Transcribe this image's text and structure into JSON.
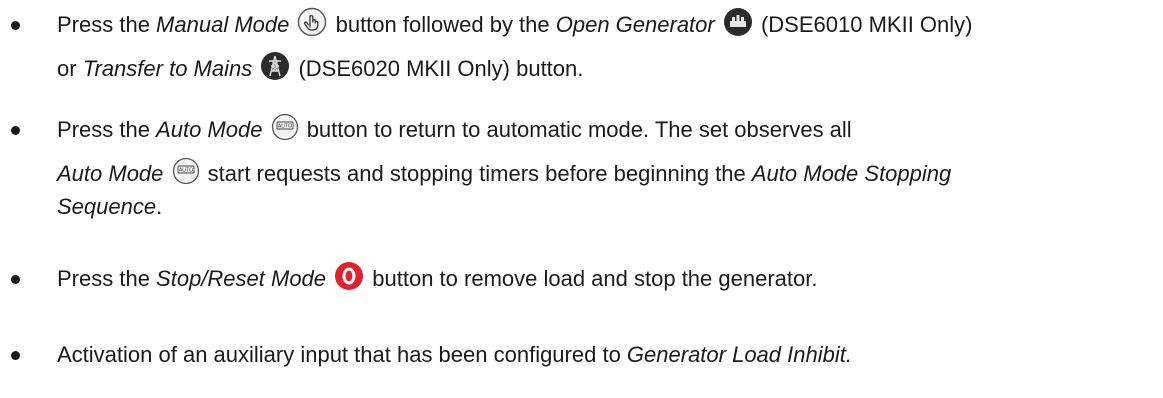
{
  "bullets": [
    {
      "l1_a": "Press the ",
      "l1_b": "Manual Mode",
      "l1_c": " button followed by the ",
      "l1_d": "Open Generator",
      "l1_e": " (DSE6010 MKII Only)",
      "l2_a": "or ",
      "l2_b": "Transfer to Mains",
      "l2_c": " (DSE6020 MKII Only) button."
    },
    {
      "l1_a": "Press the ",
      "l1_b": "Auto Mode",
      "l1_c": " button to return to automatic mode. The set observes all",
      "l2_a": "Auto Mode",
      "l2_b": "  start requests and stopping timers before beginning the ",
      "l2_c": "Auto Mode Stopping",
      "l3_a": "Sequence",
      "l3_b": "."
    },
    {
      "l1_a": "Press the ",
      "l1_b": "Stop/Reset Mode",
      "l1_c": " button to remove load and stop the generator."
    },
    {
      "l1_a": "Activation of an auxiliary input that has been configured to ",
      "l1_b": "Generator Load Inhibit."
    }
  ],
  "icons": {
    "manual_mode": "hand-pointer-icon",
    "open_generator": "generator-icon",
    "transfer_to_mains": "mains-pylon-icon",
    "auto_mode": "auto-button-icon",
    "auto_mode_text": "AUTO",
    "stop_reset": "stop-reset-icon",
    "stop_reset_color": "#e0202a"
  }
}
